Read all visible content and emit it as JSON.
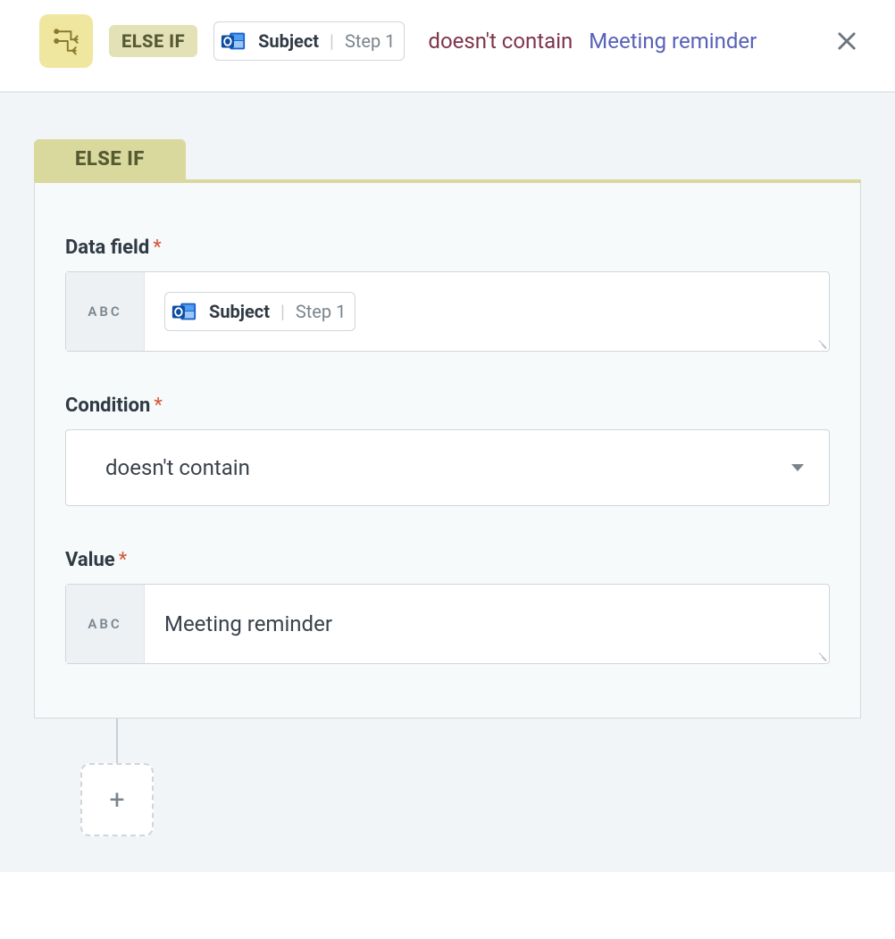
{
  "header": {
    "elseif_label": "ELSE IF",
    "chip": {
      "field": "Subject",
      "step": "Step 1"
    },
    "condition_text": "doesn't contain",
    "value_text": "Meeting reminder"
  },
  "panel": {
    "tab_label": "ELSE IF",
    "fields": {
      "data_field": {
        "label": "Data field",
        "type_hint": "ABC",
        "chip": {
          "field": "Subject",
          "step": "Step 1"
        }
      },
      "condition": {
        "label": "Condition",
        "selected": "doesn't contain"
      },
      "value": {
        "label": "Value",
        "type_hint": "ABC",
        "text": "Meeting reminder"
      }
    }
  },
  "required_marker": "*",
  "add_button_glyph": "+"
}
